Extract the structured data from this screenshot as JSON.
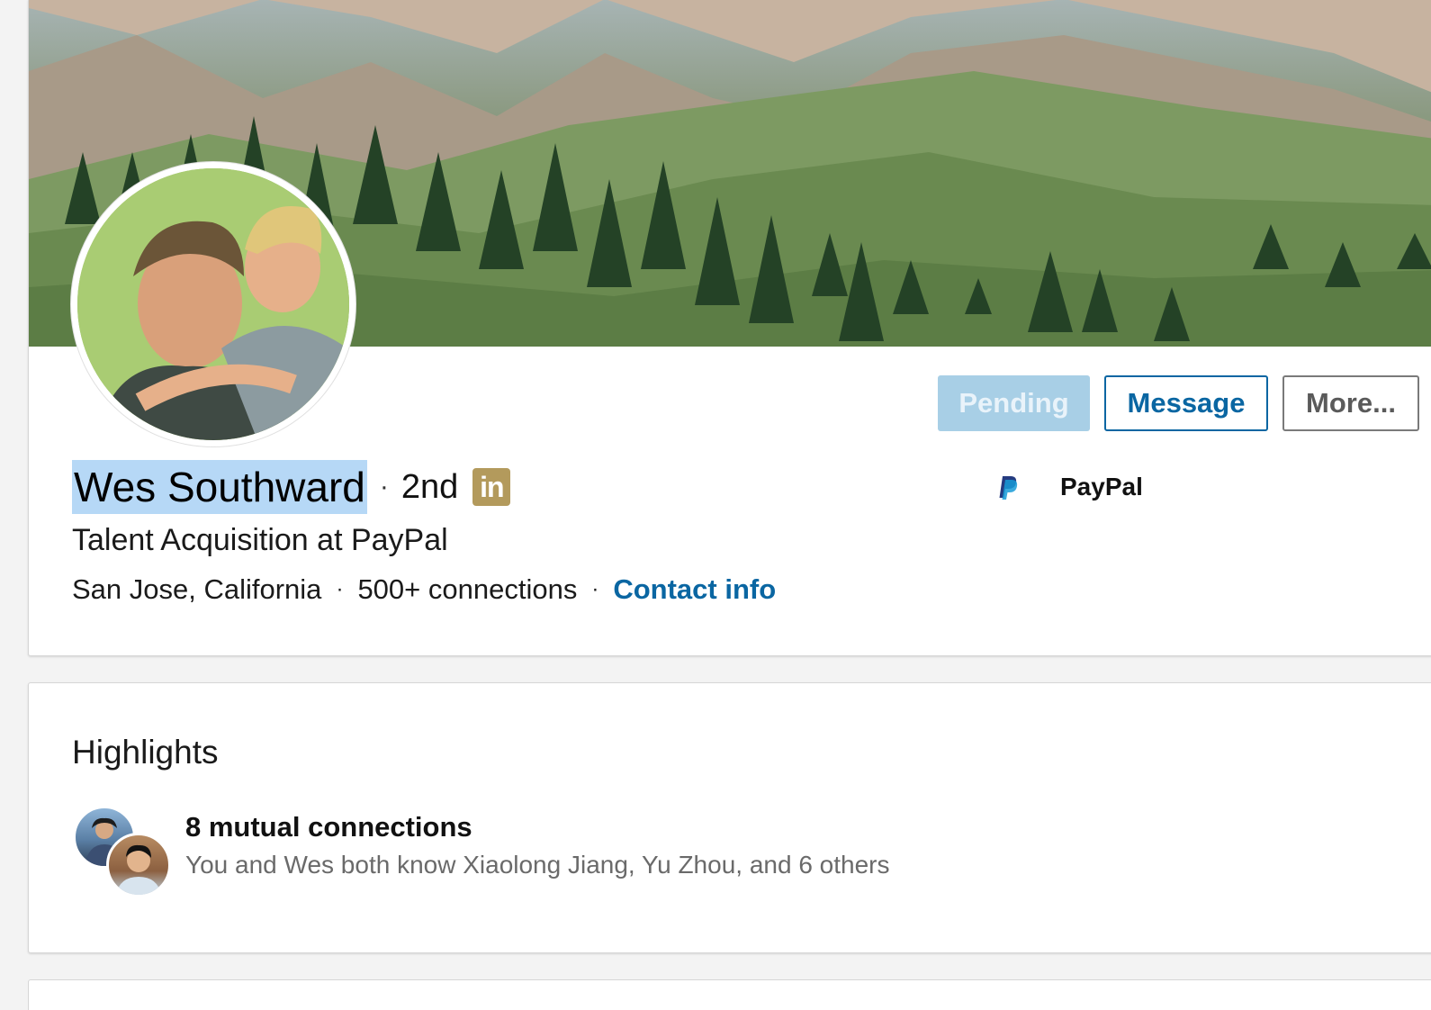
{
  "profile": {
    "name": "Wes Southward",
    "degree": "2nd",
    "degree_separator": "·",
    "linkedin_badge": "in",
    "headline": "Talent Acquisition at PayPal",
    "location": "San Jose, California",
    "connections": "500+ connections",
    "contact_link": "Contact info",
    "meta_separator": "·",
    "company": {
      "name": "PayPal",
      "logo_icon": "paypal-logo-icon"
    },
    "actions": {
      "pending": "Pending",
      "message": "Message",
      "more": "More..."
    }
  },
  "highlights": {
    "title": "Highlights",
    "mutual": {
      "title": "8 mutual connections",
      "subtitle": "You and Wes both know Xiaolong Jiang, Yu Zhou, and 6 others"
    }
  },
  "colors": {
    "link_blue": "#0a66a2",
    "pending_bg": "#a8cfe6",
    "selection_highlight": "#b6d8f6",
    "premium_badge": "#b39a5c",
    "page_bg": "#f3f3f3"
  }
}
